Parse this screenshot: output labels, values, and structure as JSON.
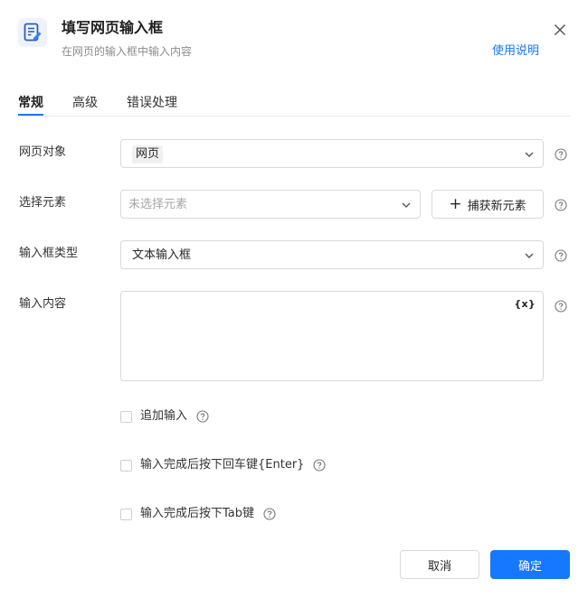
{
  "header": {
    "title": "填写网页输入框",
    "subtitle": "在网页的输入框中输入内容",
    "help_link": "使用说明",
    "icon": "edit-document-icon"
  },
  "tabs": [
    {
      "label": "常规",
      "active": true
    },
    {
      "label": "高级",
      "active": false
    },
    {
      "label": "错误处理",
      "active": false
    }
  ],
  "form": {
    "web_object": {
      "label": "网页对象",
      "value": "网页"
    },
    "select_element": {
      "label": "选择元素",
      "placeholder": "未选择元素",
      "capture_button": "捕获新元素"
    },
    "input_type": {
      "label": "输入框类型",
      "value": "文本输入框"
    },
    "input_content": {
      "label": "输入内容",
      "value": "",
      "variable_button": "{x}"
    }
  },
  "options": [
    {
      "label": "追加输入",
      "checked": false
    },
    {
      "label": "输入完成后按下回车键{Enter}",
      "checked": false
    },
    {
      "label": "输入完成后按下Tab键",
      "checked": false
    }
  ],
  "footer": {
    "cancel": "取消",
    "ok": "确定"
  },
  "colors": {
    "accent": "#1677ff",
    "border": "#d9d9d9"
  }
}
